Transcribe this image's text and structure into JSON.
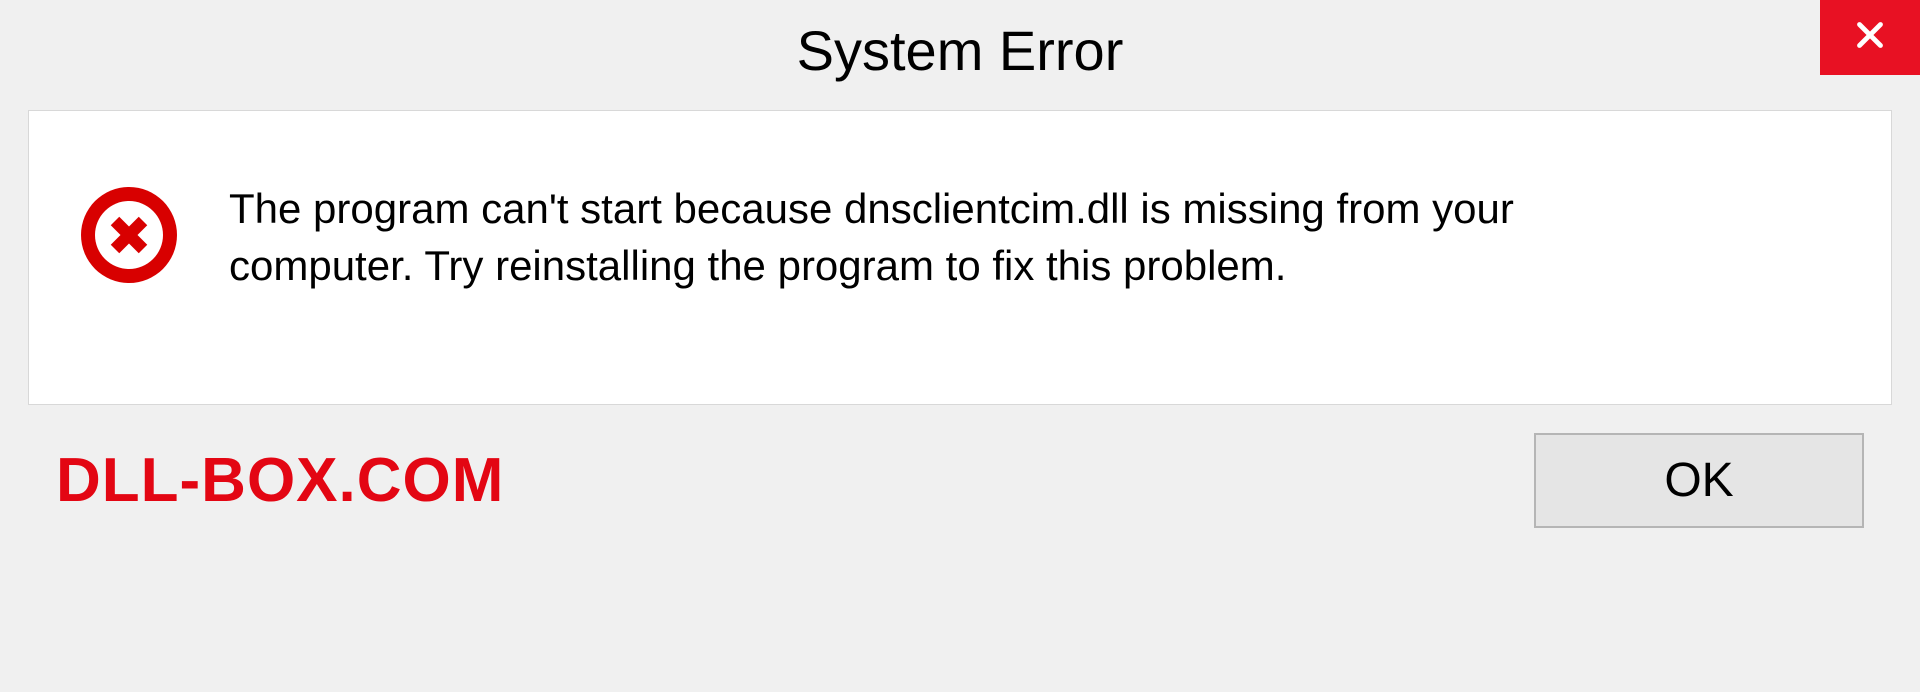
{
  "titlebar": {
    "title": "System Error"
  },
  "content": {
    "message": "The program can't start because dnsclientcim.dll is missing from your computer. Try reinstalling the program to fix this problem."
  },
  "footer": {
    "watermark": "DLL-BOX.COM",
    "ok_label": "OK"
  },
  "colors": {
    "close_bg": "#e81123",
    "error_icon": "#d80000",
    "watermark": "#e30613"
  }
}
